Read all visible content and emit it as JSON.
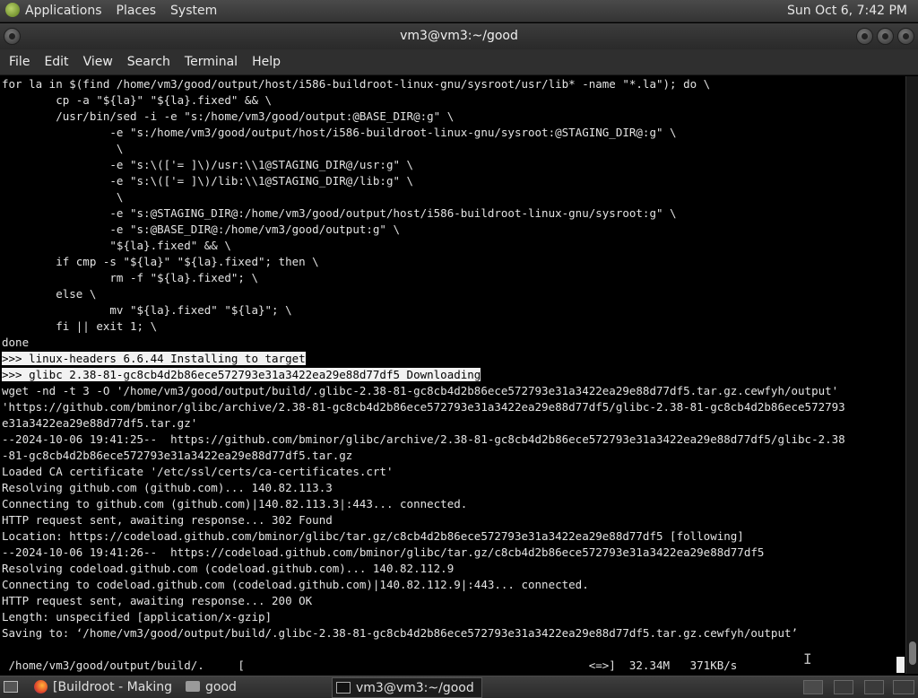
{
  "top_panel": {
    "menus": [
      "Applications",
      "Places",
      "System"
    ],
    "clock": "Sun Oct  6,  7:42 PM"
  },
  "window": {
    "title": "vm3@vm3:~/good"
  },
  "menu_bar": [
    "File",
    "Edit",
    "View",
    "Search",
    "Terminal",
    "Help"
  ],
  "terminal": {
    "lines": [
      {
        "text": "for la in $(find /home/vm3/good/output/host/i586-buildroot-linux-gnu/sysroot/usr/lib* -name \"*.la\"); do \\",
        "hl": false
      },
      {
        "text": "        cp -a \"${la}\" \"${la}.fixed\" && \\",
        "hl": false
      },
      {
        "text": "        /usr/bin/sed -i -e \"s:/home/vm3/good/output:@BASE_DIR@:g\" \\",
        "hl": false
      },
      {
        "text": "                -e \"s:/home/vm3/good/output/host/i586-buildroot-linux-gnu/sysroot:@STAGING_DIR@:g\" \\",
        "hl": false
      },
      {
        "text": "                 \\",
        "hl": false
      },
      {
        "text": "                -e \"s:\\(['= ]\\)/usr:\\\\1@STAGING_DIR@/usr:g\" \\",
        "hl": false
      },
      {
        "text": "                -e \"s:\\(['= ]\\)/lib:\\\\1@STAGING_DIR@/lib:g\" \\",
        "hl": false
      },
      {
        "text": "                 \\",
        "hl": false
      },
      {
        "text": "                -e \"s:@STAGING_DIR@:/home/vm3/good/output/host/i586-buildroot-linux-gnu/sysroot:g\" \\",
        "hl": false
      },
      {
        "text": "                -e \"s:@BASE_DIR@:/home/vm3/good/output:g\" \\",
        "hl": false
      },
      {
        "text": "                \"${la}.fixed\" && \\",
        "hl": false
      },
      {
        "text": "        if cmp -s \"${la}\" \"${la}.fixed\"; then \\",
        "hl": false
      },
      {
        "text": "                rm -f \"${la}.fixed\"; \\",
        "hl": false
      },
      {
        "text": "        else \\",
        "hl": false
      },
      {
        "text": "                mv \"${la}.fixed\" \"${la}\"; \\",
        "hl": false
      },
      {
        "text": "        fi || exit 1; \\",
        "hl": false
      },
      {
        "text": "done",
        "hl": false
      },
      {
        "text": ">>> linux-headers 6.6.44 Installing to target",
        "hl": true
      },
      {
        "text": ">>> glibc 2.38-81-gc8cb4d2b86ece572793e31a3422ea29e88d77df5 Downloading",
        "hl": true
      },
      {
        "text": "wget -nd -t 3 -O '/home/vm3/good/output/build/.glibc-2.38-81-gc8cb4d2b86ece572793e31a3422ea29e88d77df5.tar.gz.cewfyh/output'",
        "hl": false
      },
      {
        "text": "'https://github.com/bminor/glibc/archive/2.38-81-gc8cb4d2b86ece572793e31a3422ea29e88d77df5/glibc-2.38-81-gc8cb4d2b86ece572793",
        "hl": false
      },
      {
        "text": "e31a3422ea29e88d77df5.tar.gz'",
        "hl": false
      },
      {
        "text": "--2024-10-06 19:41:25--  https://github.com/bminor/glibc/archive/2.38-81-gc8cb4d2b86ece572793e31a3422ea29e88d77df5/glibc-2.38",
        "hl": false
      },
      {
        "text": "-81-gc8cb4d2b86ece572793e31a3422ea29e88d77df5.tar.gz",
        "hl": false
      },
      {
        "text": "Loaded CA certificate '/etc/ssl/certs/ca-certificates.crt'",
        "hl": false
      },
      {
        "text": "Resolving github.com (github.com)... 140.82.113.3",
        "hl": false
      },
      {
        "text": "Connecting to github.com (github.com)|140.82.113.3|:443... connected.",
        "hl": false
      },
      {
        "text": "HTTP request sent, awaiting response... 302 Found",
        "hl": false
      },
      {
        "text": "Location: https://codeload.github.com/bminor/glibc/tar.gz/c8cb4d2b86ece572793e31a3422ea29e88d77df5 [following]",
        "hl": false
      },
      {
        "text": "--2024-10-06 19:41:26--  https://codeload.github.com/bminor/glibc/tar.gz/c8cb4d2b86ece572793e31a3422ea29e88d77df5",
        "hl": false
      },
      {
        "text": "Resolving codeload.github.com (codeload.github.com)... 140.82.112.9",
        "hl": false
      },
      {
        "text": "Connecting to codeload.github.com (codeload.github.com)|140.82.112.9|:443... connected.",
        "hl": false
      },
      {
        "text": "HTTP request sent, awaiting response... 200 OK",
        "hl": false
      },
      {
        "text": "Length: unspecified [application/x-gzip]",
        "hl": false
      },
      {
        "text": "Saving to: ‘/home/vm3/good/output/build/.glibc-2.38-81-gc8cb4d2b86ece572793e31a3422ea29e88d77df5.tar.gz.cewfyh/output’",
        "hl": false
      }
    ],
    "progress_line": " /home/vm3/good/output/build/.     [                                                   <=>]  32.34M   371KB/s"
  },
  "scrollbar": {
    "position": 0.985,
    "visible_fraction": 0.04
  },
  "taskbar": {
    "tasks": [
      {
        "label": "[Buildroot - Making ...",
        "icon": "firefox-icon",
        "active": false
      },
      {
        "label": "good",
        "icon": "folder-icon",
        "active": false
      },
      {
        "label": "vm3@vm3:~/good",
        "icon": "terminal-icon",
        "active": true
      }
    ]
  }
}
